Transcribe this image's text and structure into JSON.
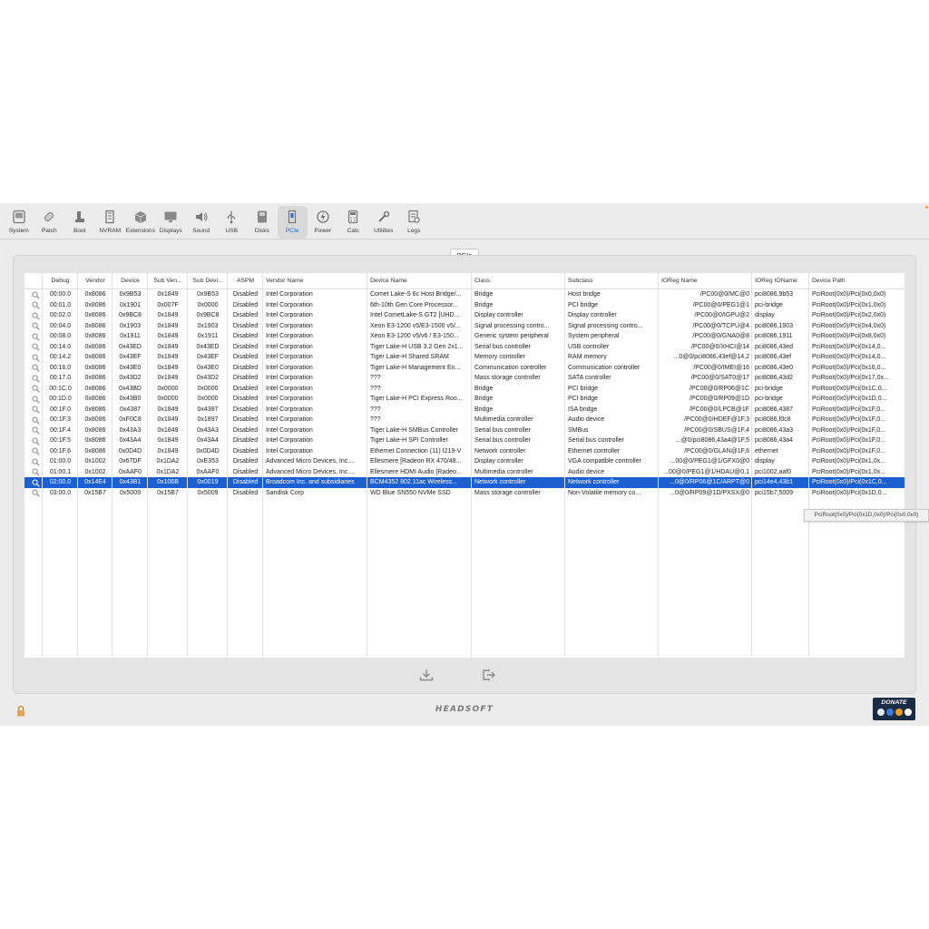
{
  "toolbar": {
    "items": [
      {
        "label": "System",
        "icon": "system-icon"
      },
      {
        "label": "Patch",
        "icon": "patch-icon"
      },
      {
        "label": "Boot",
        "icon": "boot-icon"
      },
      {
        "label": "NVRAM",
        "icon": "nvram-icon"
      },
      {
        "label": "Extensions",
        "icon": "extensions-icon"
      },
      {
        "label": "Displays",
        "icon": "displays-icon"
      },
      {
        "label": "Sound",
        "icon": "sound-icon"
      },
      {
        "label": "USB",
        "icon": "usb-icon"
      },
      {
        "label": "Disks",
        "icon": "disks-icon"
      },
      {
        "label": "PCIe",
        "icon": "pcie-icon",
        "active": true
      },
      {
        "label": "Power",
        "icon": "power-icon"
      },
      {
        "label": "Calc",
        "icon": "calc-icon"
      },
      {
        "label": "Utilities",
        "icon": "utilities-icon"
      },
      {
        "label": "Logs",
        "icon": "logs-icon"
      }
    ]
  },
  "segment": {
    "label": "PCIe"
  },
  "table": {
    "columns": [
      "Debug",
      "Vendor",
      "Device",
      "Sub Ven...",
      "Sub Devi...",
      "ASPM",
      "Vendor Name",
      "Device Name",
      "Class",
      "Subclass",
      "IOReg Name",
      "IOReg IOName",
      "Device Path"
    ],
    "selected_index": 18,
    "rows": [
      [
        "00:00.0",
        "0x8086",
        "0x9B53",
        "0x1849",
        "0x9B53",
        "Disabled",
        "Intel Corporation",
        "Comet Lake-S 6c Host Bridge/...",
        "Bridge",
        "Host bridge",
        "/PC00@0/MC@0",
        "pci8086,9b53",
        "PciRoot(0x0)/Pci(0x0,0x0)"
      ],
      [
        "00:01.0",
        "0x8086",
        "0x1901",
        "0x007F",
        "0x0000",
        "Disabled",
        "Intel Corporation",
        "6th-10th Gen Core Processor...",
        "Bridge",
        "PCI bridge",
        "/PC00@0/PEG1@1",
        "pci-bridge",
        "PciRoot(0x0)/Pci(0x1,0x0)"
      ],
      [
        "00:02.0",
        "0x8086",
        "0x9BC8",
        "0x1849",
        "0x9BC8",
        "Disabled",
        "Intel Corporation",
        "Intel CometLake-S GT2 [UHD...",
        "Display controller",
        "Display controller",
        "/PC00@0/IGPU@2",
        "display",
        "PciRoot(0x0)/Pci(0x2,0x0)"
      ],
      [
        "00:04.0",
        "0x8086",
        "0x1903",
        "0x1849",
        "0x1903",
        "Disabled",
        "Intel Corporation",
        "Xeon E3-1200 v5/E3-1500 v5/...",
        "Signal processing contro...",
        "Signal processing contro...",
        "/PC00@0/TCPU@4",
        "pci8086,1903",
        "PciRoot(0x0)/Pci(0x4,0x0)"
      ],
      [
        "00:08.0",
        "0x8086",
        "0x1911",
        "0x1849",
        "0x1911",
        "Disabled",
        "Intel Corporation",
        "Xeon E3-1200 v5/v6 / E3-150...",
        "Generic system peripheral",
        "System peripheral",
        "/PC00@0/GNA0@8",
        "pci8086,1911",
        "PciRoot(0x0)/Pci(0x8,0x0)"
      ],
      [
        "00:14.0",
        "0x8086",
        "0x43ED",
        "0x1849",
        "0x43ED",
        "Disabled",
        "Intel Corporation",
        "Tiger Lake-H USB 3.2 Gen 2x1...",
        "Serial bus controller",
        "USB controller",
        "/PC00@0/XHCI@14",
        "pci8086,43ed",
        "PciRoot(0x0)/Pci(0x14,0..."
      ],
      [
        "00:14.2",
        "0x8086",
        "0x43EF",
        "0x1849",
        "0x43EF",
        "Disabled",
        "Intel Corporation",
        "Tiger Lake-H Shared SRAM",
        "Memory controller",
        "RAM memory",
        "...0@0/pci8086,43ef@14,2",
        "pci8086,43ef",
        "PciRoot(0x0)/Pci(0x14,0..."
      ],
      [
        "00:16.0",
        "0x8086",
        "0x43E0",
        "0x1849",
        "0x43E0",
        "Disabled",
        "Intel Corporation",
        "Tiger Lake-H Management En...",
        "Communication controller",
        "Communication controller",
        "/PC00@0/IMEI@16",
        "pci8086,43e0",
        "PciRoot(0x0)/Pci(0x16,0..."
      ],
      [
        "00:17.0",
        "0x8086",
        "0x43D2",
        "0x1849",
        "0x43D2",
        "Disabled",
        "Intel Corporation",
        "???",
        "Mass storage controller",
        "SATA controller",
        "/PC00@0/SAT0@17",
        "pci8086,43d2",
        "PciRoot(0x0)/Pci(0x17,0x..."
      ],
      [
        "00:1C.0",
        "0x8086",
        "0x43BD",
        "0x0000",
        "0x0000",
        "Disabled",
        "Intel Corporation",
        "???",
        "Bridge",
        "PCI bridge",
        "/PC00@0/RP06@1C",
        "pci-bridge",
        "PciRoot(0x0)/Pci(0x1C,0..."
      ],
      [
        "00:1D.0",
        "0x8086",
        "0x43B0",
        "0x0000",
        "0x0000",
        "Disabled",
        "Intel Corporation",
        "Tiger Lake-H PCI Express Roo...",
        "Bridge",
        "PCI bridge",
        "/PC00@0/RP09@1D",
        "pci-bridge",
        "PciRoot(0x0)/Pci(0x1D,0..."
      ],
      [
        "00:1F.0",
        "0x8086",
        "0x4387",
        "0x1849",
        "0x4387",
        "Disabled",
        "Intel Corporation",
        "???",
        "Bridge",
        "ISA bridge",
        "/PC00@0/LPCB@1F",
        "pci8086,4387",
        "PciRoot(0x0)/Pci(0x1F,0..."
      ],
      [
        "00:1F.3",
        "0x8086",
        "0xF0C8",
        "0x1849",
        "0x1897",
        "Disabled",
        "Intel Corporation",
        "???",
        "Multimedia controller",
        "Audio device",
        "/PC00@0/HDEF@1F,3",
        "pci8086,f0c8",
        "PciRoot(0x0)/Pci(0x1F,0..."
      ],
      [
        "00:1F.4",
        "0x8086",
        "0x43A3",
        "0x1849",
        "0x43A3",
        "Disabled",
        "Intel Corporation",
        "Tiger Lake-H SMBus Controller",
        "Serial bus controller",
        "SMBus",
        "/PC00@0/SBUS@1F,4",
        "pci8086,43a3",
        "PciRoot(0x0)/Pci(0x1F,0..."
      ],
      [
        "00:1F.5",
        "0x8086",
        "0x43A4",
        "0x1849",
        "0x43A4",
        "Disabled",
        "Intel Corporation",
        "Tiger Lake-H SPI Controller",
        "Serial bus controller",
        "Serial bus controller",
        "...@0/pci8086,43a4@1F,5",
        "pci8086,43a4",
        "PciRoot(0x0)/Pci(0x1F,0..."
      ],
      [
        "00:1F.6",
        "0x8086",
        "0x0D4D",
        "0x1849",
        "0x0D4D",
        "Disabled",
        "Intel Corporation",
        "Ethernet Connection (11) I219-V",
        "Network controller",
        "Ethernet controller",
        "/PC00@0/GLAN@1F,6",
        "ethernet",
        "PciRoot(0x0)/Pci(0x1F,0..."
      ],
      [
        "01:00.0",
        "0x1002",
        "0x67DF",
        "0x1DA2",
        "0xE353",
        "Disabled",
        "Advanced Micro Devices, Inc....",
        "Ellesmere [Radeon RX 470/48...",
        "Display controller",
        "VGA compatible controller",
        "...00@0/PEG1@1/GFX0@0",
        "display",
        "PciRoot(0x0)/Pci(0x1,0x..."
      ],
      [
        "01:00.1",
        "0x1002",
        "0xAAF0",
        "0x1DA2",
        "0xAAF0",
        "Disabled",
        "Advanced Micro Devices, Inc....",
        "Ellesmere HDMI Audio [Radeo...",
        "Multimedia controller",
        "Audio device",
        "...00@0/PEG1@1/HDAU@0,1",
        "pci1002,aaf0",
        "PciRoot(0x0)/Pci(0x1,0x..."
      ],
      [
        "02:00.0",
        "0x14E4",
        "0x43B1",
        "0x106B",
        "0x0019",
        "Disabled",
        "Broadcom Inc. and subsidiaries",
        "BCM4352 802.11ac Wireless...",
        "Network controller",
        "Network controller",
        "...0@0/RP06@1C/ARPT@0",
        "pci14e4,43b1",
        "PciRoot(0x0)/Pci(0x1C,0..."
      ],
      [
        "03:00.0",
        "0x15B7",
        "0x5009",
        "0x15B7",
        "0x5009",
        "Disabled",
        "Sandisk Corp",
        "WD Blue SN550 NVMe SSD",
        "Mass storage controller",
        "Non-Volatile memory co...",
        "...0@0/RP09@1D/PXSX@0",
        "pci15b7,5009",
        "PciRoot(0x0)/Pci(0x1D,0..."
      ]
    ]
  },
  "tooltip": {
    "text": "PciRoot(0x0)/Pci(0x1D,0x0)/Pci(0x0,0x0)"
  },
  "footer": {
    "logo": "HEADSOFT",
    "donate": "DONATE"
  },
  "colors": {
    "selection": "#1c5fd0",
    "accent": "#1f6ed4"
  }
}
